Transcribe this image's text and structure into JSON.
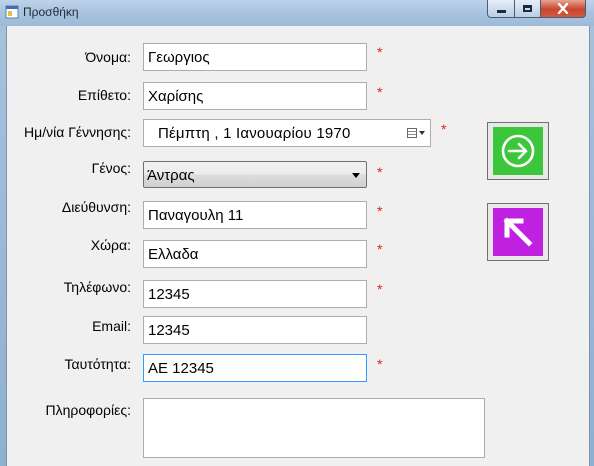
{
  "window": {
    "title": "Προσθήκη",
    "controls": [
      "minimize-icon",
      "maximize-icon",
      "close-icon"
    ]
  },
  "form": {
    "first_name": {
      "label": "Όνομα:",
      "value": "Γεωργιος",
      "required": "*"
    },
    "last_name": {
      "label": "Επίθετο:",
      "value": "Χαρίσης",
      "required": "*"
    },
    "birth_date": {
      "label": "Ημ/νία Γέννησης:",
      "value": "Πέμπτη   ,   1   Ιανουαρίου   1970",
      "required": "*",
      "icon": "calendar-icon"
    },
    "gender": {
      "label": "Γένος:",
      "value": "Άντρας",
      "required": "*"
    },
    "address": {
      "label": "Διεύθυνση:",
      "value": "Παναγουλη 11",
      "required": "*"
    },
    "country": {
      "label": "Χώρα:",
      "value": "Ελλαδα",
      "required": "*"
    },
    "phone": {
      "label": "Τηλέφωνο:",
      "value": "12345",
      "required": "*"
    },
    "email": {
      "label": "Email:",
      "value": "12345"
    },
    "id_card": {
      "label": "Ταυτότητα:",
      "value": "ΑΕ 12345",
      "required": "*"
    },
    "info": {
      "label": "Πληροφορίες:",
      "value": ""
    }
  },
  "buttons": {
    "submit": {
      "icon": "arrow-right-circle-icon",
      "color": "#3cc63c"
    },
    "back": {
      "icon": "arrow-up-left-icon",
      "color": "#c020e0"
    }
  },
  "colors": {
    "required_star": "#e02020",
    "focus_border": "#3399ff"
  }
}
